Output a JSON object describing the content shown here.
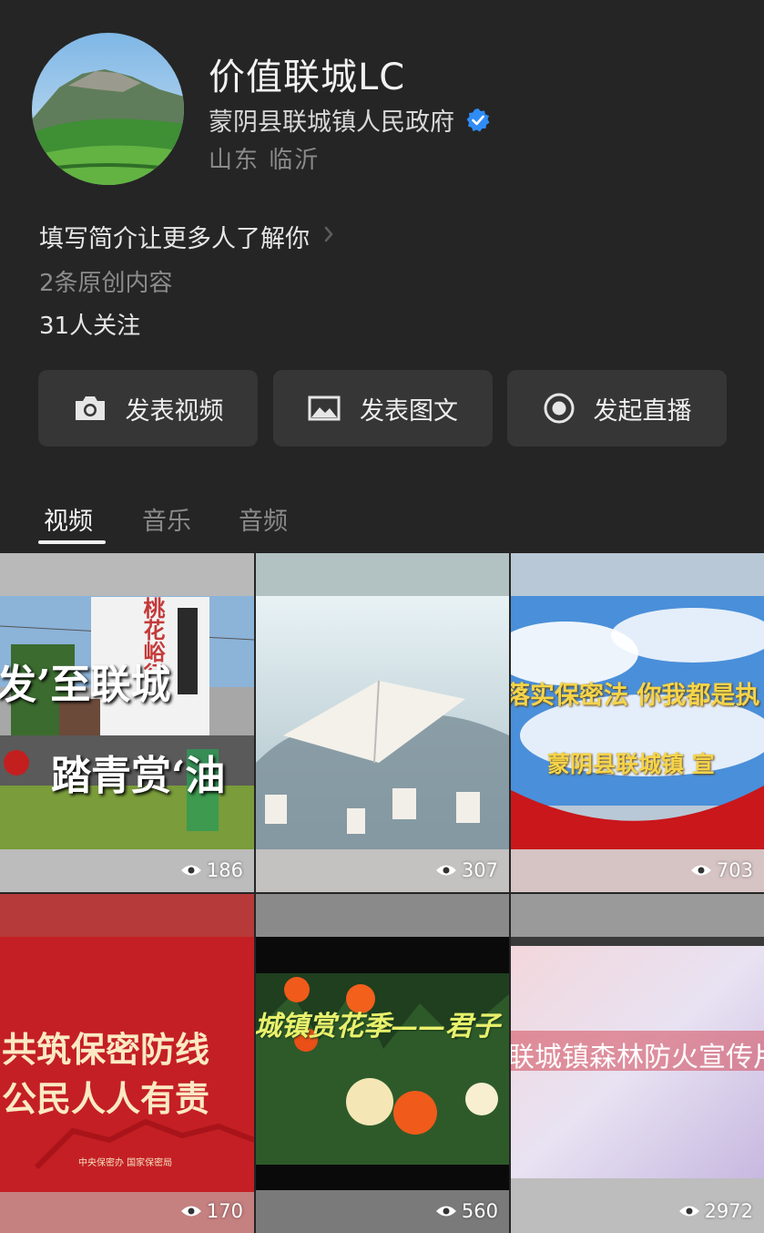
{
  "profile": {
    "name": "价值联城LC",
    "org": "蒙阴县联城镇人民政府",
    "location": "山东 临沂",
    "bio_prompt": "填写简介让更多人了解你",
    "original_count": "2条原创内容",
    "followers": "31人关注"
  },
  "actions": [
    {
      "label": "发表视频",
      "icon": "camera-icon"
    },
    {
      "label": "发表图文",
      "icon": "image-icon"
    },
    {
      "label": "发起直播",
      "icon": "live-icon"
    }
  ],
  "tabs": [
    "视频",
    "音乐",
    "音频"
  ],
  "videos": [
    {
      "views": "186",
      "overlay_line1": "发’至联城",
      "overlay_line2": "踏青赏‘油",
      "sign_text": "桃花峪行"
    },
    {
      "views": "307"
    },
    {
      "views": "703",
      "overlay_line1": "落实保密法 你我都是执",
      "overlay_line2": "蒙阴县联城镇 宣"
    },
    {
      "views": "170",
      "overlay_line1": "共筑保密防线",
      "overlay_line2": "公民人人有责",
      "caption": "中央保密办 国家保密局"
    },
    {
      "views": "560",
      "overlay_line1": "城镇赏花季——君子"
    },
    {
      "views": "2972",
      "overlay_line1": "联城镇森林防火宣传片"
    }
  ],
  "colors": {
    "background": "#252525",
    "button_bg": "#363636",
    "verified_blue": "#2f8cf5"
  }
}
